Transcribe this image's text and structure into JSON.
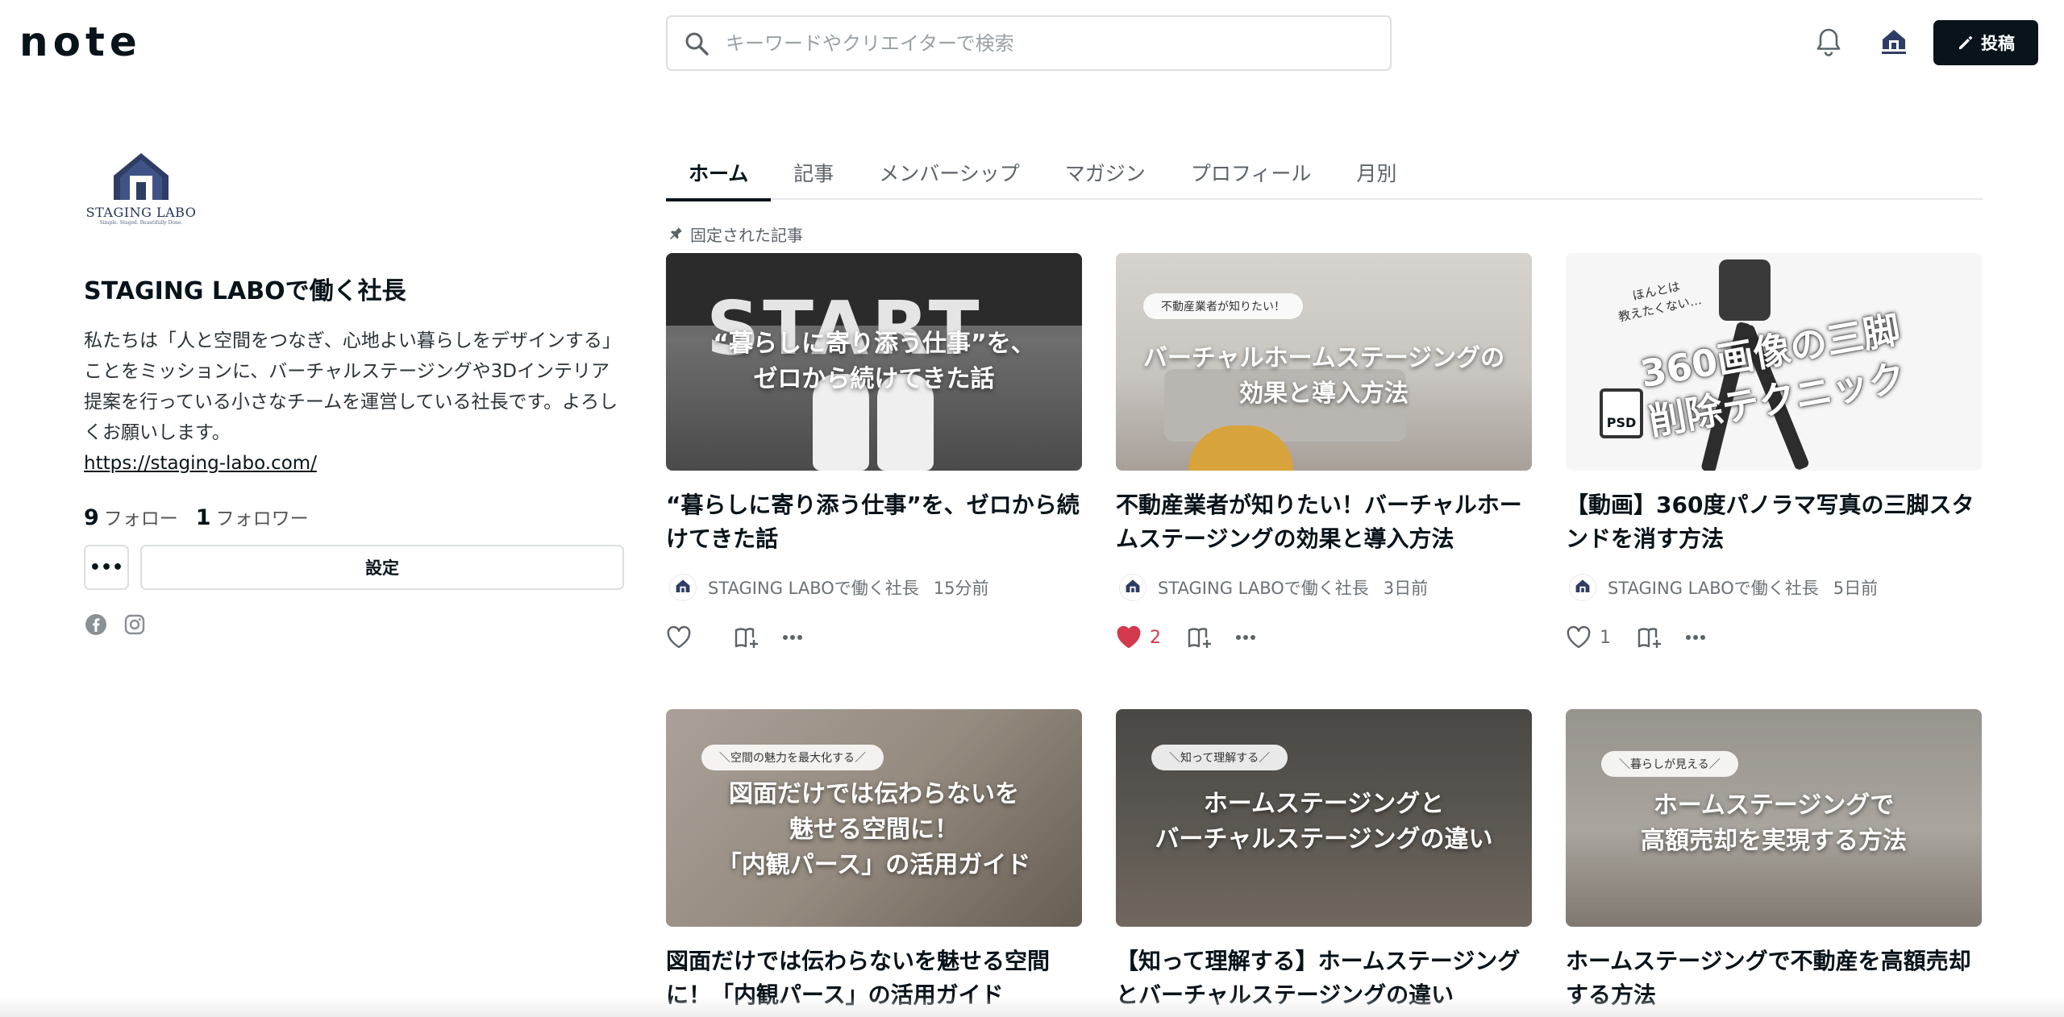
{
  "header": {
    "logo_text": "note",
    "search_placeholder": "キーワードやクリエイターで検索",
    "post_label": "投稿",
    "icons": [
      "search-icon",
      "bell-icon",
      "pencil-icon"
    ]
  },
  "profile": {
    "logo_brand": "STAGING LABO",
    "logo_tagline": "Simple. Staged. Beautifully Done.",
    "name": "STAGING LABOで働く社長",
    "bio": "私たちは「人と空間をつなぎ、心地よい暮らしをデザインする」ことをミッションに、バーチャルステージングや3Dインテリア提案を行っている小さなチームを運営している社長です。よろしくお願いします。",
    "link": "https://staging-labo.com/",
    "follow_count": "9",
    "follow_label": "フォロー",
    "follower_count": "1",
    "follower_label": "フォロワー",
    "more_label": "•••",
    "settings_label": "設定",
    "socials": [
      "facebook-icon",
      "instagram-icon"
    ]
  },
  "tabs": [
    {
      "label": "ホーム",
      "active": true
    },
    {
      "label": "記事",
      "active": false
    },
    {
      "label": "メンバーシップ",
      "active": false
    },
    {
      "label": "マガジン",
      "active": false
    },
    {
      "label": "プロフィール",
      "active": false
    },
    {
      "label": "月別",
      "active": false
    }
  ],
  "pinned_label": "固定された記事",
  "articles": [
    {
      "thumb_text_1": "“暮らしに寄り添う仕事”を、",
      "thumb_text_2": "ゼロから続けてきた話",
      "title": "“暮らしに寄り添う仕事”を、ゼロから続けてきた話",
      "author": "STAGING LABOで働く社長",
      "time": "15分前",
      "likes": "",
      "liked": false
    },
    {
      "thumb_bubble": "不動産業者が知りたい！",
      "thumb_text_1": "バーチャルホームステージングの",
      "thumb_text_2": "効果と導入方法",
      "title": "不動産業者が知りたい！バーチャルホームステージングの効果と導入方法",
      "author": "STAGING LABOで働く社長",
      "time": "3日前",
      "likes": "2",
      "liked": true
    },
    {
      "thumb_note_1": "ほんとは",
      "thumb_note_2": "教えたくない…",
      "thumb_text_1": "360画像の三脚",
      "thumb_text_2": "削除テクニック",
      "thumb_psd": "PSD",
      "title": "【動画】360度パノラマ写真の三脚スタンドを消す方法",
      "author": "STAGING LABOで働く社長",
      "time": "5日前",
      "likes": "1",
      "liked": false
    },
    {
      "thumb_bubble": "＼空間の魅力を最大化する／",
      "thumb_text_1": "図面だけでは伝わらないを",
      "thumb_text_2": "魅せる空間に！",
      "thumb_text_3": "「内観パース」の活用ガイド",
      "title": "図面だけでは伝わらないを魅せる空間に！「内観パース」の活用ガイド"
    },
    {
      "thumb_bubble": "＼知って理解する／",
      "thumb_text_1": "ホームステージングと",
      "thumb_text_2": "バーチャルステージングの違い",
      "title": "【知って理解する】ホームステージングとバーチャルステージングの違い"
    },
    {
      "thumb_bubble": "＼暮らしが見える／",
      "thumb_text_1": "ホームステージングで",
      "thumb_text_2": "高額売却を実現する方法",
      "title": "ホームステージングで不動産を高額売却する方法"
    }
  ],
  "colors": {
    "primary": "#08131a",
    "liked": "#d3394d",
    "border": "#dcdfe1",
    "muted": "#6b7175"
  }
}
